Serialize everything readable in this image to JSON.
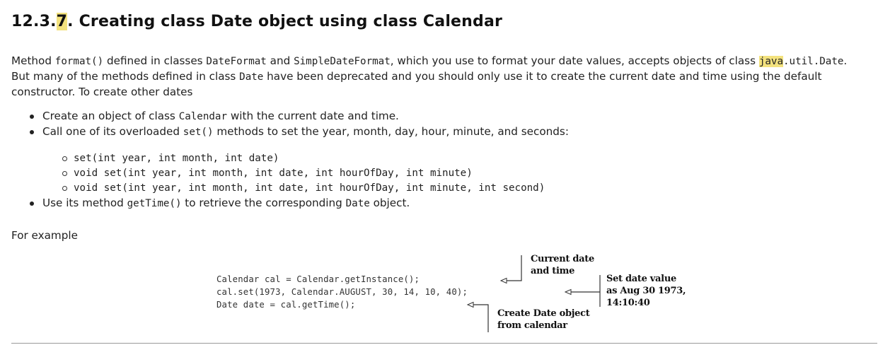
{
  "heading": {
    "prefix": "12.3.",
    "highlight": "7",
    "rest": ". Creating class Date object using class Calendar"
  },
  "intro": {
    "t1": "Method ",
    "c1": "format()",
    "t2": " defined in classes ",
    "c2": "DateFormat",
    "t3": " and ",
    "c3": "SimpleDateFormat",
    "t4": ", which you use to format your date values, accepts objects of class ",
    "c4_hl": "java",
    "c4": ".util.Date",
    "t5": ". But many of the methods defined in class ",
    "c5": "Date",
    "t6": " have been deprecated and you should only use it to create the current date and time using the default constructor. To create other dates"
  },
  "bullets": {
    "b1": {
      "t1": "Create an object of class ",
      "c1": "Calendar",
      "t2": " with the current date and time."
    },
    "b2": {
      "t1": "Call one of its overloaded ",
      "c1": "set()",
      "t2": " methods to set the year, month, day, hour, minute, and seconds:"
    },
    "sub": [
      "set(int year, int month, int date)",
      "void set(int year, int month, int date, int hourOfDay, int minute)",
      "void set(int year, int month, int date, int hourOfDay, int minute, int second)"
    ],
    "b3": {
      "t1": "Use its method ",
      "c1": "getTime()",
      "t2": " to retrieve the corresponding ",
      "c2": "Date",
      "t3": " object."
    }
  },
  "for_example": "For example",
  "figure": {
    "code": [
      "Calendar cal = Calendar.getInstance();",
      "cal.set(1973, Calendar.AUGUST, 30, 14, 10, 40);",
      "Date date = cal.getTime();"
    ],
    "notes": {
      "current": [
        "Current date",
        "and time"
      ],
      "setvalue": [
        "Set date value",
        "as Aug 30 1973,",
        "14:10:40"
      ],
      "create": [
        "Create Date object",
        "from calendar"
      ]
    }
  }
}
